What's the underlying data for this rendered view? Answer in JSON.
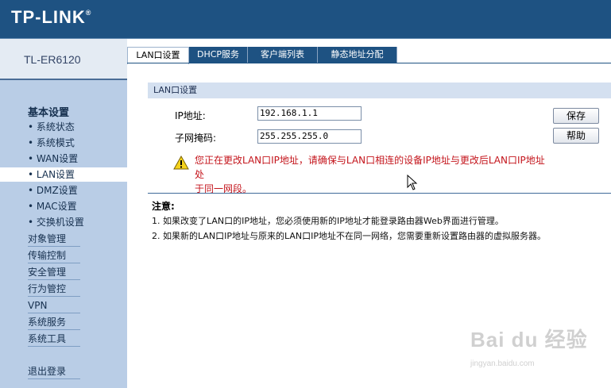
{
  "brand": {
    "logo": "TP-LINK",
    "trademark": "®",
    "model": "TL-ER6120"
  },
  "sidebar": {
    "heading": "基本设置",
    "subitems": [
      "• 系统状态",
      "• 系统模式",
      "• WAN设置",
      "• LAN设置",
      "• DMZ设置",
      "• MAC设置",
      "• 交换机设置"
    ],
    "active_subitem": "• LAN设置",
    "sections": [
      "对象管理",
      "传输控制",
      "安全管理",
      "行为管控",
      "VPN",
      "系统服务",
      "系统工具"
    ],
    "logout": "退出登录"
  },
  "tabs": [
    {
      "label": "LAN口设置",
      "active": true
    },
    {
      "label": "DHCP服务",
      "active": false
    },
    {
      "label": "客户端列表",
      "active": false
    },
    {
      "label": "静态地址分配",
      "active": false
    }
  ],
  "panel": {
    "title": "LAN口设置",
    "ip_label": "IP地址:",
    "ip_value": "192.168.1.1",
    "mask_label": "子网掩码:",
    "mask_value": "255.255.255.0",
    "save_button": "保存",
    "help_button": "帮助",
    "warning_line1": "您正在更改LAN口IP地址，请确保与LAN口相连的设备IP地址与更改后LAN口IP地址处",
    "warning_line2": "于同一网段。"
  },
  "notes": {
    "heading": "注意:",
    "items": [
      "1. 如果改变了LAN口的IP地址，您必须使用新的IP地址才能登录路由器Web界面进行管理。",
      "2. 如果新的LAN口IP地址与原来的LAN口IP地址不在同一网络，您需要重新设置路由器的虚拟服务器。"
    ]
  },
  "watermark": {
    "main": "Bai du 经验",
    "sub": "jingyan.baidu.com"
  },
  "colors": {
    "header": "#1e5282",
    "sidebar": "#b9cde6",
    "warning": "#c4151c",
    "panel_title": "#d4e0f0"
  },
  "icons": {
    "warning": "warning-triangle-icon",
    "cursor": "mouse-pointer-icon"
  }
}
